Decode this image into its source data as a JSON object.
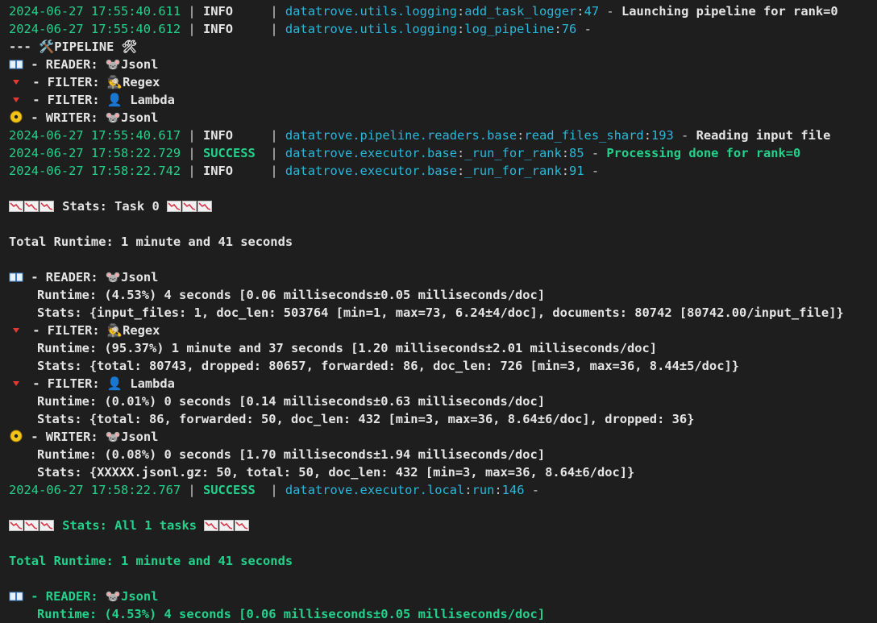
{
  "lines": [
    {
      "kind": "log",
      "ts": "2024-06-27 17:55:40.611",
      "level": "INFO",
      "module": "datatrove.utils.logging",
      "func": "add_task_logger",
      "lineno": "47",
      "message": "Launching pipeline for rank=0"
    },
    {
      "kind": "log",
      "ts": "2024-06-27 17:55:40.612",
      "level": "INFO",
      "module": "datatrove.utils.logging",
      "func": "log_pipeline",
      "lineno": "76",
      "message": ""
    },
    {
      "kind": "text",
      "text": "--- 🛠️PIPELINE 🛠"
    },
    {
      "kind": "step",
      "icon": "book",
      "text": "- READER: 🐭Jsonl"
    },
    {
      "kind": "step",
      "icon": "filter",
      "text": "- FILTER: 🕵Regex"
    },
    {
      "kind": "step",
      "icon": "filter",
      "text": "- FILTER: 👤 Lambda"
    },
    {
      "kind": "step",
      "icon": "disk",
      "text": "- WRITER: 🐭Jsonl"
    },
    {
      "kind": "log",
      "ts": "2024-06-27 17:55:40.617",
      "level": "INFO",
      "module": "datatrove.pipeline.readers.base",
      "func": "read_files_shard",
      "lineno": "193",
      "message": "Reading input file"
    },
    {
      "kind": "log",
      "ts": "2024-06-27 17:58:22.729",
      "level": "SUCCESS",
      "module": "datatrove.executor.base",
      "func": "_run_for_rank",
      "lineno": "85",
      "message": "Processing done for rank=0"
    },
    {
      "kind": "log",
      "ts": "2024-06-27 17:58:22.742",
      "level": "INFO",
      "module": "datatrove.executor.base",
      "func": "_run_for_rank",
      "lineno": "91",
      "message": ""
    },
    {
      "kind": "blank"
    },
    {
      "kind": "stats",
      "text": "Stats: Task 0",
      "color": "white"
    },
    {
      "kind": "blank"
    },
    {
      "kind": "text",
      "text": "Total Runtime: 1 minute and 41 seconds"
    },
    {
      "kind": "blank"
    },
    {
      "kind": "step",
      "icon": "book",
      "text": "- READER: 🐭Jsonl"
    },
    {
      "kind": "indent",
      "text": "Runtime: (4.53%) 4 seconds [0.06 milliseconds±0.05 milliseconds/doc]"
    },
    {
      "kind": "indent",
      "text": "Stats: {input_files: 1, doc_len: 503764 [min=1, max=73, 6.24±4/doc], documents: 80742 [80742.00/input_file]}"
    },
    {
      "kind": "step",
      "icon": "filter",
      "text": "- FILTER: 🕵Regex"
    },
    {
      "kind": "indent",
      "text": "Runtime: (95.37%) 1 minute and 37 seconds [1.20 milliseconds±2.01 milliseconds/doc]"
    },
    {
      "kind": "indent",
      "text": "Stats: {total: 80743, dropped: 80657, forwarded: 86, doc_len: 726 [min=3, max=36, 8.44±5/doc]}"
    },
    {
      "kind": "step",
      "icon": "filter",
      "text": "- FILTER: 👤 Lambda"
    },
    {
      "kind": "indent",
      "text": "Runtime: (0.01%) 0 seconds [0.14 milliseconds±0.63 milliseconds/doc]"
    },
    {
      "kind": "indent",
      "text": "Stats: {total: 86, forwarded: 50, doc_len: 432 [min=3, max=36, 8.64±6/doc], dropped: 36}"
    },
    {
      "kind": "step",
      "icon": "disk",
      "text": "- WRITER: 🐭Jsonl"
    },
    {
      "kind": "indent",
      "text": "Runtime: (0.08%) 0 seconds [1.70 milliseconds±1.94 milliseconds/doc]"
    },
    {
      "kind": "indent",
      "text": "Stats: {XXXXX.jsonl.gz: 50, total: 50, doc_len: 432 [min=3, max=36, 8.64±6/doc]}"
    },
    {
      "kind": "log",
      "ts": "2024-06-27 17:58:22.767",
      "level": "SUCCESS",
      "module": "datatrove.executor.local",
      "func": "run",
      "lineno": "146",
      "message": ""
    },
    {
      "kind": "blank"
    },
    {
      "kind": "stats",
      "text": "Stats: All 1 tasks",
      "color": "green"
    },
    {
      "kind": "blank"
    },
    {
      "kind": "greentext",
      "text": "Total Runtime: 1 minute and 41 seconds"
    },
    {
      "kind": "blank"
    },
    {
      "kind": "step",
      "icon": "book",
      "text": "- READER: 🐭Jsonl",
      "color": "green"
    },
    {
      "kind": "indentgreen",
      "text": "Runtime: (4.53%) 4 seconds [0.06 milliseconds±0.05 milliseconds/doc]"
    }
  ]
}
